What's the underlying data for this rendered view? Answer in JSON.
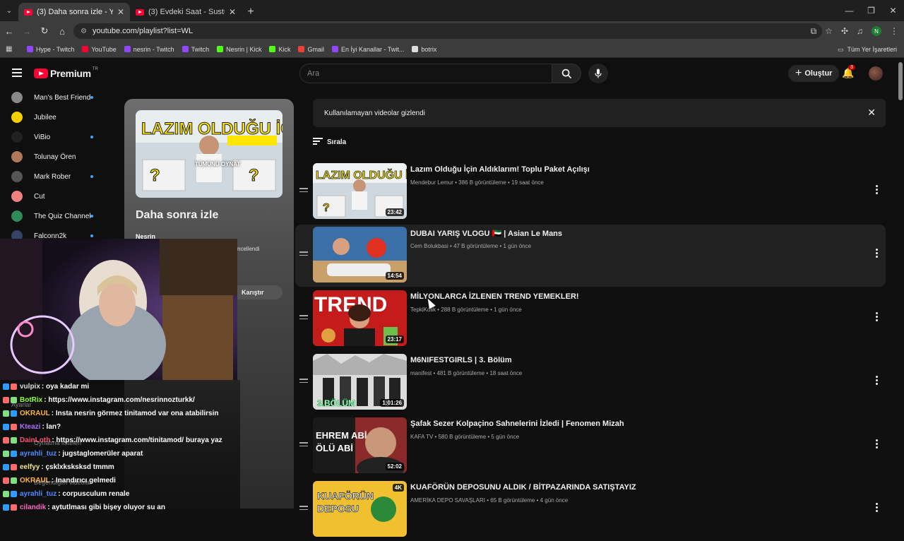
{
  "browser": {
    "tabs": [
      {
        "title": "(3) Daha sonra izle - YouTube",
        "active": true
      },
      {
        "title": "(3) Evdeki Saat - Sustum ( Live",
        "active": false
      }
    ],
    "url": "youtube.com/playlist?list=WL",
    "profile_initial": "N",
    "bookmarks": [
      {
        "label": "Hype - Twitch",
        "color": "#9146ff"
      },
      {
        "label": "YouTube",
        "color": "#ff0033"
      },
      {
        "label": "nesrin - Twitch",
        "color": "#9146ff"
      },
      {
        "label": "Twitch",
        "color": "#9146ff"
      },
      {
        "label": "Nesrin | Kick",
        "color": "#53fc18"
      },
      {
        "label": "Kick",
        "color": "#53fc18"
      },
      {
        "label": "Gmail",
        "color": "#ea4335"
      },
      {
        "label": "En İyi Kanallar - Twit...",
        "color": "#9146ff"
      },
      {
        "label": "botrix",
        "color": "#dddddd"
      }
    ],
    "all_bookmarks": "Tüm Yer İşaretleri"
  },
  "header": {
    "logo": "Premium",
    "country": "TR",
    "search_placeholder": "Ara",
    "create_label": "Oluştur",
    "notification_count": "3"
  },
  "sidebar": {
    "subscriptions": [
      {
        "name": "Man's Best Friend",
        "color": "#888888",
        "live": true
      },
      {
        "name": "Jubilee",
        "color": "#f5d000",
        "live": false
      },
      {
        "name": "ViBio",
        "color": "#222222",
        "live": true
      },
      {
        "name": "Tolunay Ören",
        "color": "#b07a5a",
        "live": false
      },
      {
        "name": "Mark Rober",
        "color": "#555555",
        "live": true
      },
      {
        "name": "Cut",
        "color": "#f08080",
        "live": false
      },
      {
        "name": "The Quiz Channel",
        "color": "#2e8b57",
        "live": true
      },
      {
        "name": "Falconn2k",
        "color": "#334466",
        "live": true
      }
    ]
  },
  "playlist": {
    "title": "Daha sonra izle",
    "owner": "Nesrin",
    "updated": "ncellendi",
    "play_all": "TÜMÜNÜ OYNAT",
    "shuffle": "Karıştır"
  },
  "chat": {
    "messages": [
      {
        "user": "vulpix",
        "text": ": oya kadar mi",
        "color": "#dddddd"
      },
      {
        "user": "BotRix",
        "text": ": https://www.instagram.com/nesrinnozturkk/",
        "color": "#8fff3a"
      },
      {
        "user": "OKRAUL",
        "text": ": Insta nesrin görmez tinitamod var ona atabilirsin",
        "color": "#ffb347"
      },
      {
        "user": "Kteazi",
        "text": ": lan?",
        "color": "#b36bff"
      },
      {
        "user": "DainLoth",
        "text": ": https://www.instagram.com/tinitamod/ buraya yaz",
        "color": "#ff4d6d"
      },
      {
        "user": "ayrahli_tuz",
        "text": ": jugstaglomerüler aparat",
        "color": "#4f8cff"
      },
      {
        "user": "eelfyy",
        "text": ": çsklxksksksd tmmm",
        "color": "#f0e68c"
      },
      {
        "user": "OKRAUL",
        "text": ": Inandırıcı gelmedi",
        "color": "#ffb347"
      },
      {
        "user": "ayrahli_tuz",
        "text": ": corpusculum renale",
        "color": "#4f8cff"
      },
      {
        "user": "cilandik",
        "text": ": aytutlması gibi bişey oluyor su an",
        "color": "#ff66c4"
      }
    ],
    "ghost_labels": [
      "Ayarlar",
      "Oynatma listeleri",
      "Beğendiğim videolar"
    ]
  },
  "main": {
    "banner_text": "Kullanılamayan videolar gizlendi",
    "sort_label": "Sırala",
    "videos": [
      {
        "title": "Lazım Olduğu İçin Aldıklarım! Toplu Paket Açılışı",
        "channel": "Mendebur Lemur",
        "views": "386 B görüntüleme",
        "ago": "19 saat önce",
        "duration": "23:42"
      },
      {
        "title": "DUBAI YARIŞ VLOGU 🇦🇪 | Asian Le Mans",
        "channel": "Cem Bolukbasi",
        "views": "47 B görüntüleme",
        "ago": "1 gün önce",
        "duration": "14:54"
      },
      {
        "title": "MİLYONLARCA İZLENEN TREND YEMEKLER!",
        "channel": "TepkiKolik",
        "views": "288 B görüntüleme",
        "ago": "1 gün önce",
        "duration": "23:17"
      },
      {
        "title": "M6NIFESTGIRLS | 3. Bölüm",
        "channel": "manifest",
        "views": "481 B görüntüleme",
        "ago": "18 saat önce",
        "duration": "1:01:26"
      },
      {
        "title": "Şafak Sezer Kolpaçino Sahnelerini İzledi | Fenomen Mizah",
        "channel": "KAFA TV",
        "views": "580 B görüntüleme",
        "ago": "5 gün önce",
        "duration": "52:02"
      },
      {
        "title": "KUAFÖRÜN DEPOSUNU ALDIK / BİTPAZARINDA SATIŞTAYIZ",
        "channel": "AMERİKA DEPO SAVAŞLARI",
        "views": "65 B görüntüleme",
        "ago": "4 gün önce",
        "duration": "4K"
      }
    ]
  }
}
